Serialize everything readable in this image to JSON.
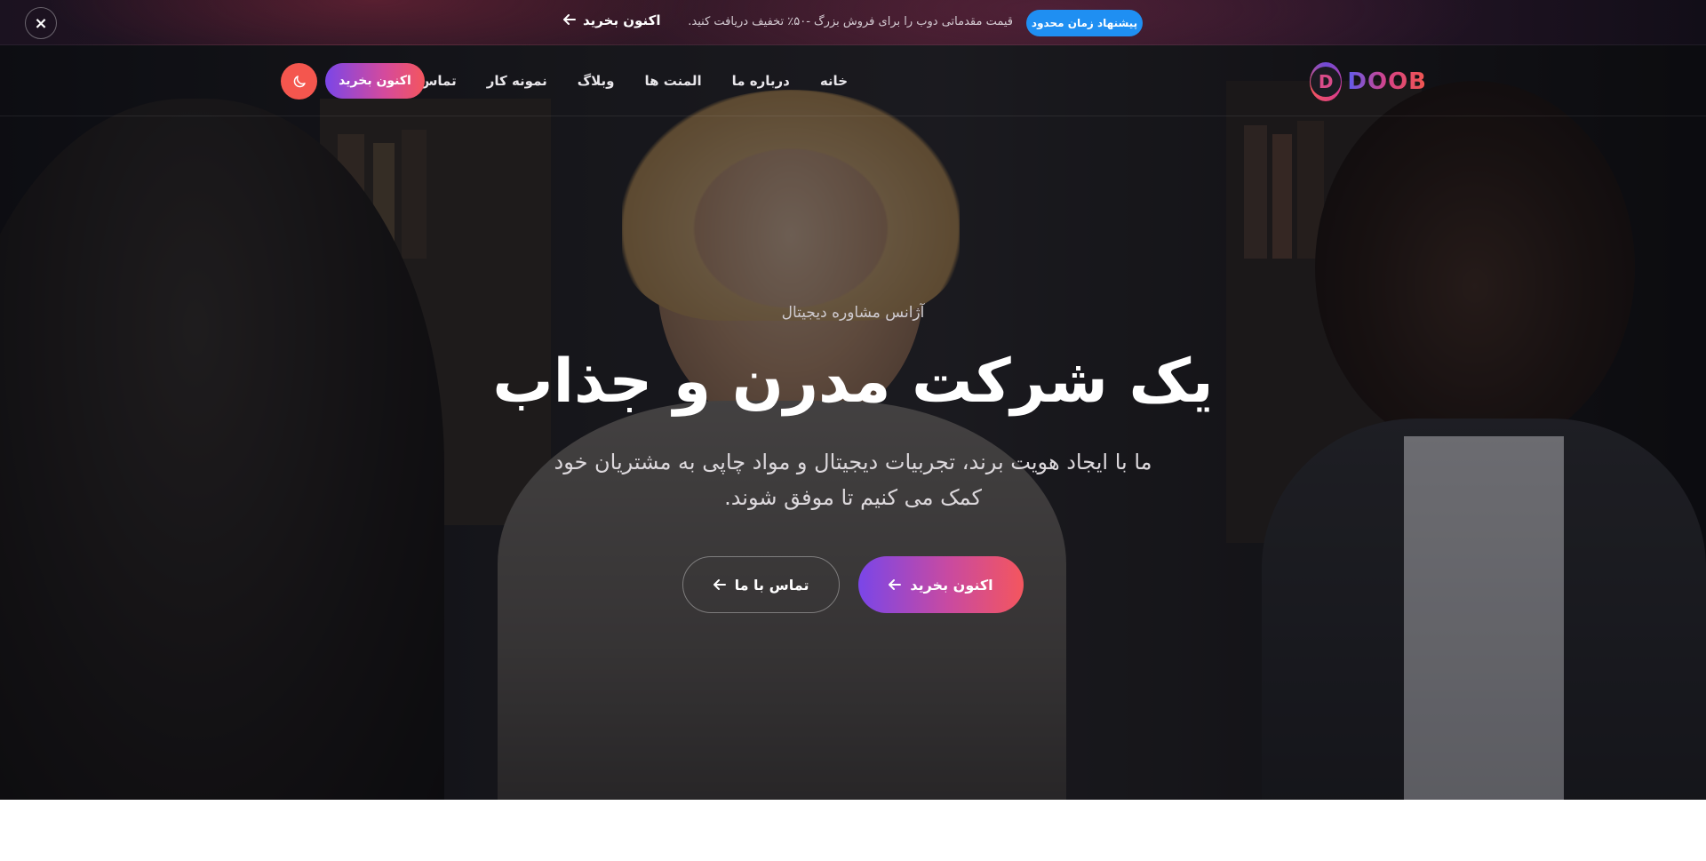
{
  "promo": {
    "badge": "پیشنهاد زمان محدود",
    "text": "قیمت مقدماتی دوب را برای فروش بزرگ -۵۰٪ تخفیف دریافت کنید.",
    "link": "اکنون بخرید",
    "close": "×"
  },
  "header": {
    "logo_text": "DOOB",
    "logo_letter": "D",
    "nav": [
      "خانه",
      "درباره ما",
      "المنت ها",
      "وبلاگ",
      "نمونه کار",
      "تماس"
    ],
    "buy_button": "اکنون بخرید"
  },
  "hero": {
    "subtitle": "آژانس مشاوره دیجیتال",
    "title": "یک شرکت مدرن و جذاب",
    "description_line1": "ما با ایجاد هویت برند، تجربیات دیجیتال و مواد چاپی به مشتریان خود",
    "description_line2": "کمک می کنیم تا موفق شوند.",
    "primary_button": "اکنون بخرید",
    "secondary_button": "تماس با ما"
  },
  "colors": {
    "accent_blue": "#1f8ff2",
    "gradient_start": "#7a46e8",
    "gradient_end": "#f4565e",
    "theme_toggle": "#f4564e"
  },
  "icons": {
    "close": "close-icon",
    "arrow": "arrow-left-icon",
    "moon": "moon-icon"
  }
}
